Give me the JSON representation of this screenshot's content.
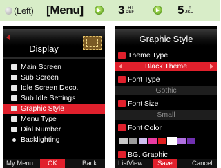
{
  "instruction": {
    "left_label": "(Left)",
    "menu_label": "[Menu]",
    "step1": {
      "digit": "3",
      "letters_top": "H I",
      "letters_bottom": "DEF"
    },
    "step2": {
      "digit": "5",
      "letters_top": "=",
      "letters_bottom": "JKL"
    }
  },
  "left_screen": {
    "title": "Display",
    "items": [
      {
        "label": "Main Screen",
        "icon": "screen-icon"
      },
      {
        "label": "Sub Screen",
        "icon": "screen-icon"
      },
      {
        "label": "Idle Screen Deco.",
        "icon": "screen-icon"
      },
      {
        "label": "Sub Idle Settings",
        "icon": "screen-icon"
      },
      {
        "label": "Graphic Style",
        "icon": "screen-icon",
        "selected": true
      },
      {
        "label": "Menu Type",
        "icon": "screen-icon"
      },
      {
        "label": "Dial Number",
        "icon": "dial-icon"
      },
      {
        "label": "Backlighting",
        "icon": "light-icon"
      }
    ],
    "softkeys": {
      "left": "My Menu",
      "center": "OK",
      "right": "Back"
    }
  },
  "right_screen": {
    "title": "Graphic Style",
    "theme_type": {
      "label": "Theme Type",
      "value": "Black Theme"
    },
    "font_type": {
      "label": "Font Type",
      "value": "Gothic"
    },
    "font_size": {
      "label": "Font Size",
      "value": "Small"
    },
    "font_color": {
      "label": "Font Color",
      "colors": [
        "#c8c8c8",
        "#9a9a9a",
        "#cfc0f0",
        "#e83ba2",
        "#e02020",
        "#ffffff",
        "#b070e0",
        "#7030b0"
      ]
    },
    "bg_graphic": {
      "label": "BG. Graphic"
    },
    "softkeys": {
      "left": "ListView",
      "center": "Save",
      "right": "Cancel"
    }
  },
  "accent_color": "#e0202c"
}
